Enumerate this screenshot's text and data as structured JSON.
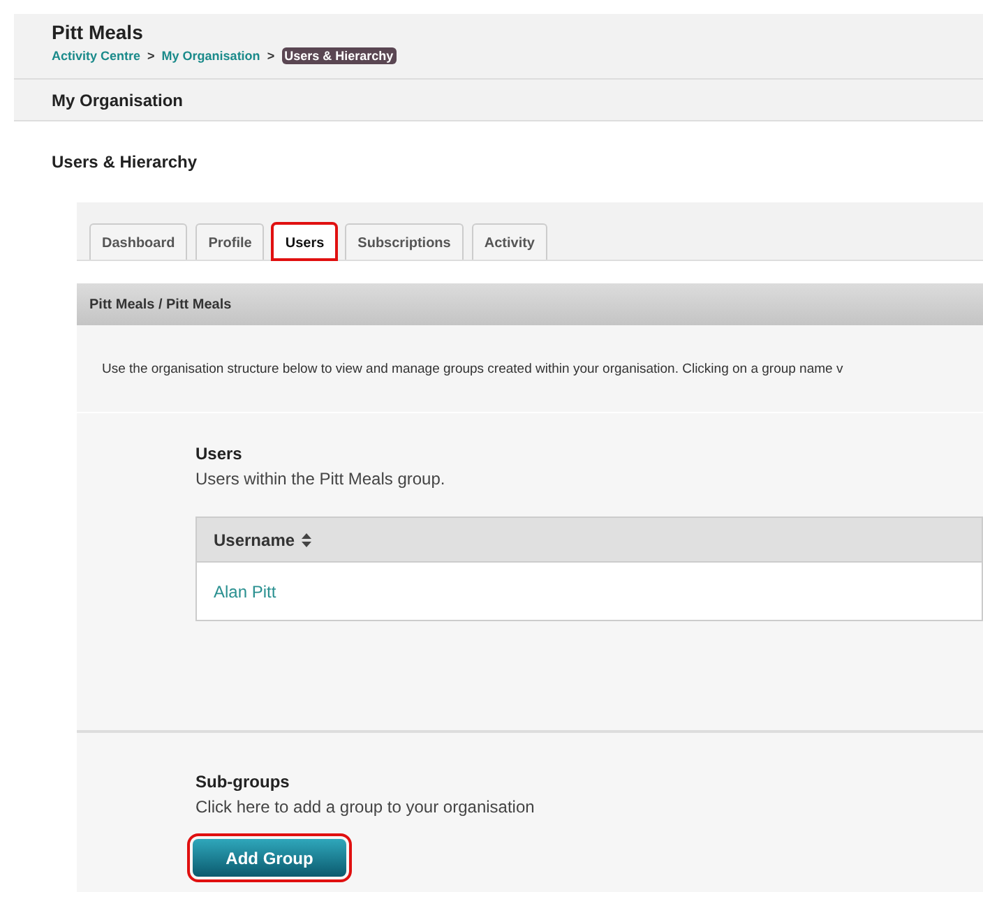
{
  "header": {
    "title": "Pitt Meals",
    "breadcrumbs": [
      {
        "label": "Activity Centre",
        "current": false
      },
      {
        "label": "My Organisation",
        "current": false
      },
      {
        "label": "Users & Hierarchy",
        "current": true
      }
    ],
    "separator": ">"
  },
  "section_bar": {
    "title": "My Organisation"
  },
  "page_title": "Users & Hierarchy",
  "tabs": [
    {
      "label": "Dashboard",
      "selected": false,
      "highlighted": false
    },
    {
      "label": "Profile",
      "selected": false,
      "highlighted": false
    },
    {
      "label": "Users",
      "selected": true,
      "highlighted": true
    },
    {
      "label": "Subscriptions",
      "selected": false,
      "highlighted": false
    },
    {
      "label": "Activity",
      "selected": false,
      "highlighted": false
    }
  ],
  "panel": {
    "title": "Pitt Meals / Pitt Meals",
    "description": "Use the organisation structure below to view and manage groups created within your organisation. Clicking on a group name v"
  },
  "users": {
    "title": "Users",
    "subtitle": "Users within the Pitt Meals group.",
    "table": {
      "columns": [
        {
          "label": "Username",
          "sortable": true
        }
      ],
      "rows": [
        [
          "Alan Pitt"
        ]
      ]
    }
  },
  "subgroups": {
    "title": "Sub-groups",
    "subtitle": "Click here to add a group to your organisation",
    "button": {
      "label": "Add Group",
      "highlighted": true
    }
  }
}
